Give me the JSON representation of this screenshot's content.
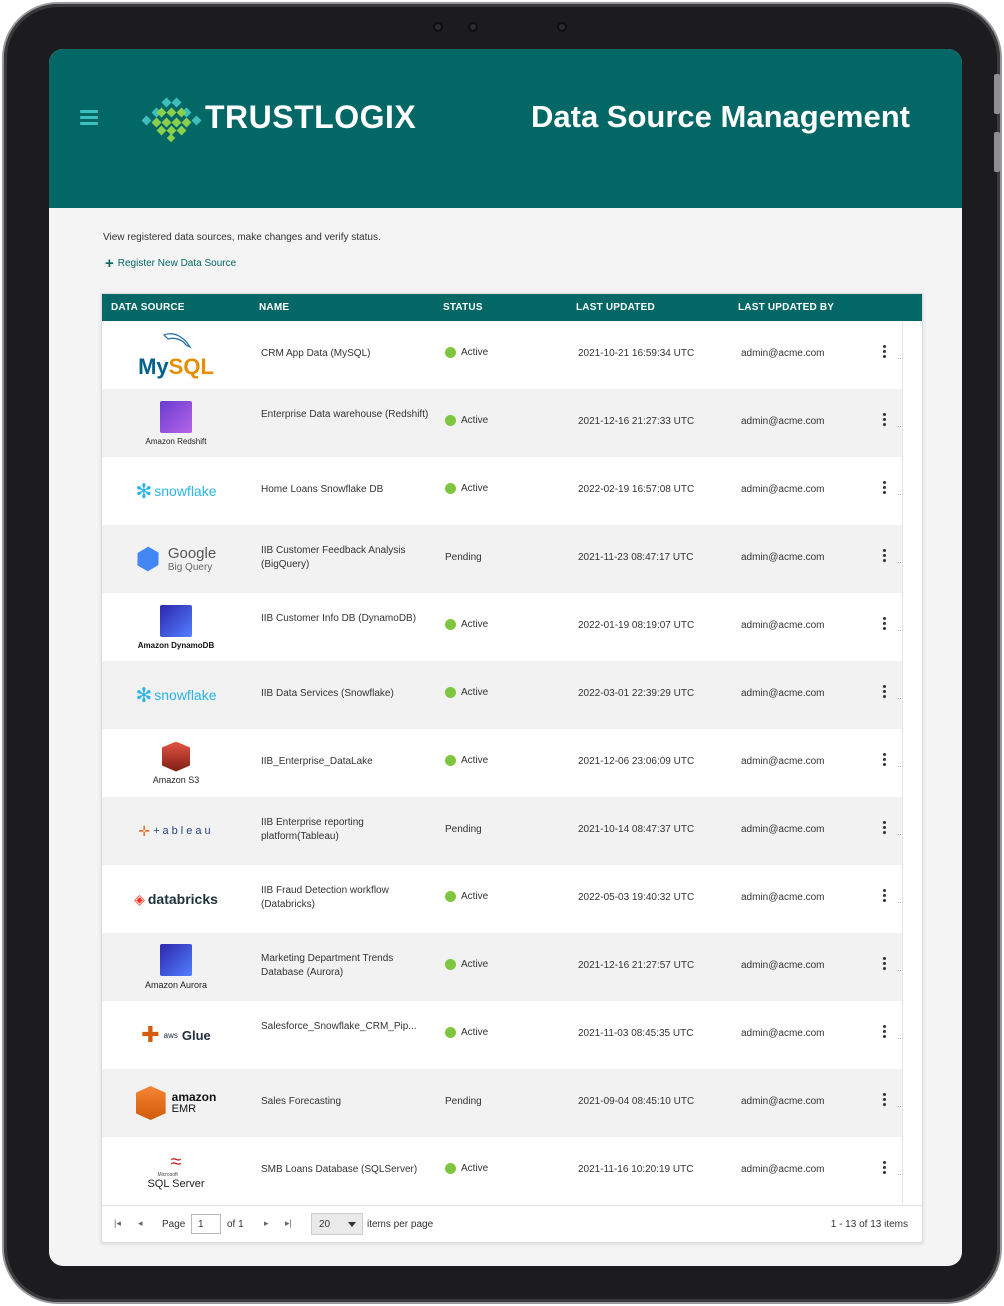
{
  "header": {
    "brand": "TRUSTLOGIX",
    "title": "Data Source Management"
  },
  "intro": {
    "description": "View registered data sources, make changes and verify status.",
    "register_label": "Register New Data Source"
  },
  "table": {
    "columns": [
      "DATA SOURCE",
      "NAME",
      "STATUS",
      "LAST UPDATED",
      "LAST UPDATED BY"
    ],
    "rows": [
      {
        "source": "MySQL",
        "source_logo_text": "MySQL",
        "name": "CRM App Data (MySQL)",
        "status": "Active",
        "updated": "2021-10-21 16:59:34 UTC",
        "by": "admin@acme.com"
      },
      {
        "source": "Amazon Redshift",
        "source_logo_text": "Amazon Redshift",
        "name": "Enterprise Data warehouse (Redshift)",
        "status": "Active",
        "updated": "2021-12-16 21:27:33 UTC",
        "by": "admin@acme.com"
      },
      {
        "source": "Snowflake",
        "source_logo_text": "snowflake",
        "name": "Home Loans Snowflake DB",
        "status": "Active",
        "updated": "2022-02-19 16:57:08 UTC",
        "by": "admin@acme.com"
      },
      {
        "source": "Google Big Query",
        "source_logo_text": "Google",
        "source_logo_sub": "Big Query",
        "name": "IIB Customer Feedback Analysis (BigQuery)",
        "status": "Pending",
        "updated": "2021-11-23 08:47:17 UTC",
        "by": "admin@acme.com"
      },
      {
        "source": "Amazon DynamoDB",
        "source_logo_text": "Amazon DynamoDB",
        "name": "IIB Customer Info DB (DynamoDB)",
        "status": "Active",
        "updated": "2022-01-19 08:19:07 UTC",
        "by": "admin@acme.com"
      },
      {
        "source": "Snowflake",
        "source_logo_text": "snowflake",
        "name": "IIB Data Services (Snowflake)",
        "status": "Active",
        "updated": "2022-03-01 22:39:29 UTC",
        "by": "admin@acme.com"
      },
      {
        "source": "Amazon S3",
        "source_logo_text": "Amazon S3",
        "name": "IIB_Enterprise_DataLake",
        "status": "Active",
        "updated": "2021-12-06 23:06:09 UTC",
        "by": "admin@acme.com"
      },
      {
        "source": "Tableau",
        "source_logo_text": "+ableau",
        "name": "IIB Enterprise reporting platform(Tableau)",
        "status": "Pending",
        "updated": "2021-10-14 08:47:37 UTC",
        "by": "admin@acme.com"
      },
      {
        "source": "Databricks",
        "source_logo_text": "databricks",
        "name": "IIB Fraud Detection workflow (Databricks)",
        "status": "Active",
        "updated": "2022-05-03 19:40:32 UTC",
        "by": "admin@acme.com"
      },
      {
        "source": "Amazon Aurora",
        "source_logo_text": "Amazon Aurora",
        "name": "Marketing Department Trends Database (Aurora)",
        "status": "Active",
        "updated": "2021-12-16 21:27:57 UTC",
        "by": "admin@acme.com"
      },
      {
        "source": "AWS Glue",
        "source_logo_text": "Glue",
        "source_logo_sub": "aws",
        "name": "Salesforce_Snowflake_CRM_Pip...",
        "status": "Active",
        "updated": "2021-11-03 08:45:35 UTC",
        "by": "admin@acme.com"
      },
      {
        "source": "Amazon EMR",
        "source_logo_text": "amazon",
        "source_logo_sub": "EMR",
        "name": "Sales Forecasting",
        "status": "Pending",
        "updated": "2021-09-04 08:45:10 UTC",
        "by": "admin@acme.com"
      },
      {
        "source": "SQL Server",
        "source_logo_text": "SQL Server",
        "source_logo_sub": "Microsoft",
        "name": "SMB Loans Database (SQLServer)",
        "status": "Active",
        "updated": "2021-11-16 10:20:19 UTC",
        "by": "admin@acme.com"
      }
    ]
  },
  "pager": {
    "page_label": "Page",
    "page_value": "1",
    "of_label": "of 1",
    "per_page_value": "20",
    "per_page_label": "items per page",
    "summary": "1 - 13 of 13 items"
  },
  "colors": {
    "header_bg": "#036766",
    "accent": "#3bc0bd",
    "active_dot": "#7cc641"
  },
  "icons": [
    "menu-icon",
    "plus-icon",
    "kebab-menu-icon",
    "first-page-icon",
    "prev-page-icon",
    "next-page-icon",
    "last-page-icon",
    "dropdown-caret-icon"
  ]
}
